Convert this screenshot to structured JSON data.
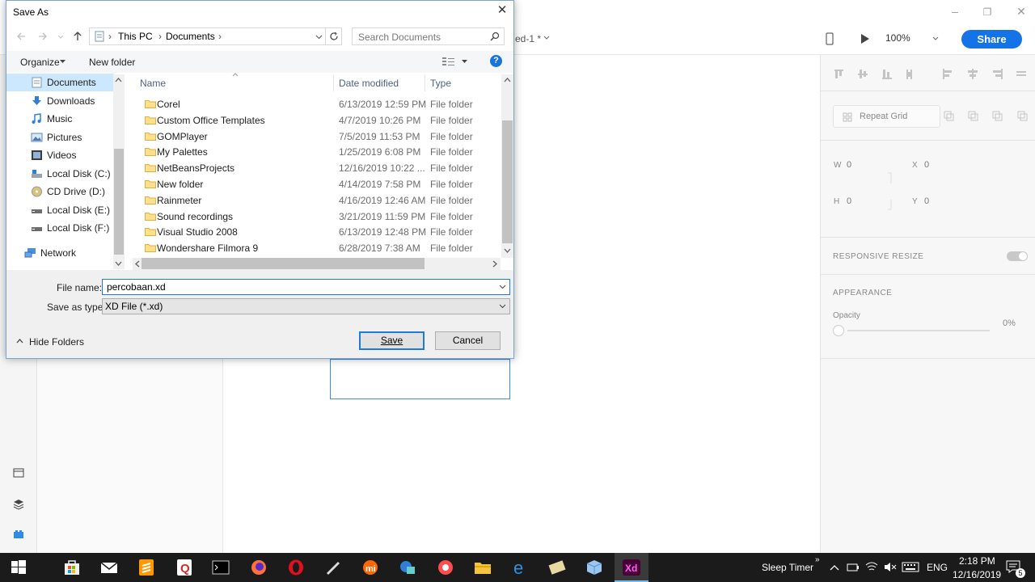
{
  "xd": {
    "doc_title": "ed-1 *",
    "zoom": "100%",
    "share_label": "Share",
    "repeat_grid_label": "Repeat Grid",
    "w_label": "W",
    "w_value": "0",
    "x_label": "X",
    "x_value": "0",
    "h_label": "H",
    "h_value": "0",
    "y_label": "Y",
    "y_value": "0",
    "responsive_resize_label": "RESPONSIVE RESIZE",
    "appearance_label": "APPEARANCE",
    "opacity_label": "Opacity",
    "opacity_value": "0%",
    "accent_color": "#1473e6"
  },
  "dialog": {
    "title": "Save As",
    "breadcrumb": [
      "This PC",
      "Documents"
    ],
    "search_placeholder": "Search Documents",
    "organize_label": "Organize",
    "new_folder_label": "New folder",
    "help_label": "?",
    "nav_items": [
      {
        "label": "Documents",
        "icon": "documents-icon",
        "selected": true
      },
      {
        "label": "Downloads",
        "icon": "downloads-icon"
      },
      {
        "label": "Music",
        "icon": "music-icon"
      },
      {
        "label": "Pictures",
        "icon": "pictures-icon"
      },
      {
        "label": "Videos",
        "icon": "videos-icon"
      },
      {
        "label": "Local Disk (C:)",
        "icon": "drive-icon"
      },
      {
        "label": "CD Drive (D:)",
        "icon": "cd-drive-icon"
      },
      {
        "label": "Local Disk (E:)",
        "icon": "drive-icon"
      },
      {
        "label": "Local Disk (F:)",
        "icon": "drive-icon"
      },
      {
        "label": "Network",
        "icon": "network-icon"
      }
    ],
    "columns": [
      "Name",
      "Date modified",
      "Type"
    ],
    "files": [
      {
        "name": "Corel",
        "date": "6/13/2019 12:59 PM",
        "type": "File folder"
      },
      {
        "name": "Custom Office Templates",
        "date": "4/7/2019 10:26 PM",
        "type": "File folder"
      },
      {
        "name": "GOMPlayer",
        "date": "7/5/2019 11:53 PM",
        "type": "File folder"
      },
      {
        "name": "My Palettes",
        "date": "1/25/2019 6:08 PM",
        "type": "File folder"
      },
      {
        "name": "NetBeansProjects",
        "date": "12/16/2019 10:22 ...",
        "type": "File folder"
      },
      {
        "name": "New folder",
        "date": "4/14/2019 7:58 PM",
        "type": "File folder"
      },
      {
        "name": "Rainmeter",
        "date": "4/16/2019 12:46 AM",
        "type": "File folder"
      },
      {
        "name": "Sound recordings",
        "date": "3/21/2019 11:59 PM",
        "type": "File folder"
      },
      {
        "name": "Visual Studio 2008",
        "date": "6/13/2019 12:48 PM",
        "type": "File folder"
      },
      {
        "name": "Wondershare Filmora 9",
        "date": "6/28/2019 7:38 AM",
        "type": "File folder"
      }
    ],
    "file_name_label": "File name:",
    "file_name_value": "percobaan.xd",
    "save_type_label": "Save as type:",
    "save_type_value": "XD File (*.xd)",
    "hide_folders_label": "Hide Folders",
    "save_label": "Save",
    "cancel_label": "Cancel"
  },
  "taskbar": {
    "sleep_timer_label": "Sleep Timer",
    "lang": "ENG",
    "time": "2:18 PM",
    "date": "12/16/2019",
    "notification_count": "5",
    "apps": [
      "start-icon",
      "store-icon",
      "mail-icon",
      "sublime-icon",
      "quickq-icon",
      "terminal-icon",
      "firefox-icon",
      "opera-icon",
      "pen-icon",
      "mi-icon",
      "app-icon",
      "gom-icon",
      "explorer-icon",
      "edge-icon",
      "tool-icon",
      "box-icon",
      "xd-icon"
    ]
  }
}
